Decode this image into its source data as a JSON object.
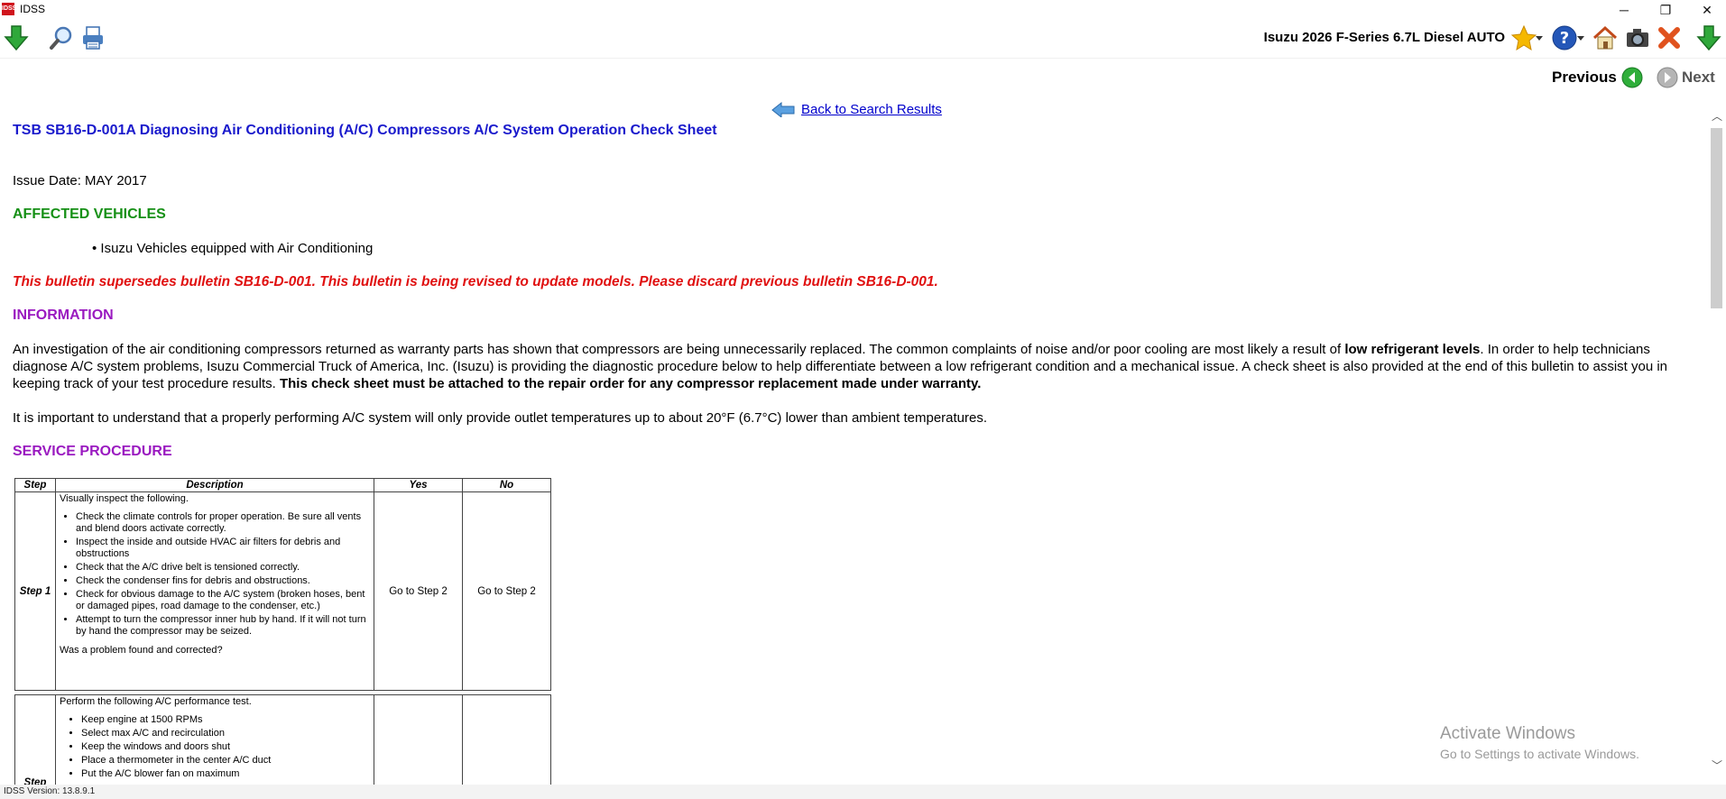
{
  "window": {
    "title": "IDSS",
    "icon_text": "IDSS",
    "minimize": "─",
    "restore": "❐",
    "close": "✕"
  },
  "toolbar": {
    "icons": [
      "download-icon",
      "search-icon",
      "print-icon",
      "favorite-star-icon",
      "help-icon",
      "home-icon",
      "camera-icon",
      "close-x-icon",
      "download-icon"
    ],
    "vehicle": "Isuzu 2026 F-Series 6.7L Diesel AUTO"
  },
  "nav": {
    "previous": "Previous",
    "next": "Next"
  },
  "doc": {
    "back_link": "Back to Search Results",
    "title": "TSB SB16-D-001A Diagnosing Air Conditioning (A/C) Compressors A/C System Operation Check Sheet",
    "issue_date": "Issue Date: MAY 2017",
    "affected_heading": "AFFECTED VEHICLES",
    "affected_item": "Isuzu Vehicles equipped with Air Conditioning",
    "supersede": "This bulletin supersedes bulletin SB16-D-001. This bulletin is being revised to update models. Please discard previous bulletin SB16-D-001.",
    "info_heading": "INFORMATION",
    "info_p1_a": "An investigation of the air conditioning compressors returned as warranty parts has shown that compressors are being unnecessarily replaced. The common complaints of noise and/or poor cooling are most likely a result of ",
    "info_p1_bold": "low refrigerant levels",
    "info_p1_b": ". In order to help technicians diagnose A/C system problems, Isuzu Commercial Truck of America, Inc. (Isuzu) is providing the diagnostic procedure below to help differentiate between a low refrigerant condition and a mechanical issue. A check sheet is also provided at the end of this bulletin to assist you in keeping track of your test procedure results. ",
    "info_p1_bold2": "This check sheet must be attached to the repair order for any compressor replacement made under warranty.",
    "info_p2": "It is important to understand that a properly performing A/C system will only provide outlet temperatures up to about 20°F (6.7°C) lower than ambient temperatures.",
    "service_heading": "SERVICE PROCEDURE"
  },
  "table": {
    "headers": [
      "Step",
      "Description",
      "Yes",
      "No"
    ],
    "step1": {
      "label": "Step 1",
      "intro": "Visually inspect the following.",
      "items": [
        "Check the climate controls for proper operation. Be sure all vents and blend doors activate correctly.",
        "Inspect the inside and outside HVAC air filters for debris and obstructions",
        "Check that the A/C drive belt is tensioned correctly.",
        "Check the condenser fins for debris and obstructions.",
        "Check for obvious damage to the A/C system (broken hoses, bent or damaged pipes, road damage to the condenser, etc.)",
        "Attempt to turn the compressor inner hub by hand. If it will not turn by hand the compressor may be seized."
      ],
      "question": "Was a problem found and corrected?",
      "yes": "Go to Step 2",
      "no": "Go to Step 2"
    },
    "step2": {
      "label": "Step",
      "intro": "Perform the following A/C performance test.",
      "items": [
        "Keep engine at 1500 RPMs",
        "Select max A/C and recirculation",
        "Keep the windows and doors shut",
        "Place a thermometer in the center A/C duct",
        "Put the A/C blower fan on maximum"
      ]
    }
  },
  "watermark": {
    "line1": "Activate Windows",
    "line2": "Go to Settings to activate Windows."
  },
  "status": {
    "version": "IDSS Version: 13.8.9.1"
  },
  "colors": {
    "title_blue": "#1a1acc",
    "heading_green": "#169016",
    "heading_purple": "#9a1ac0",
    "warning_red": "#e01010"
  }
}
